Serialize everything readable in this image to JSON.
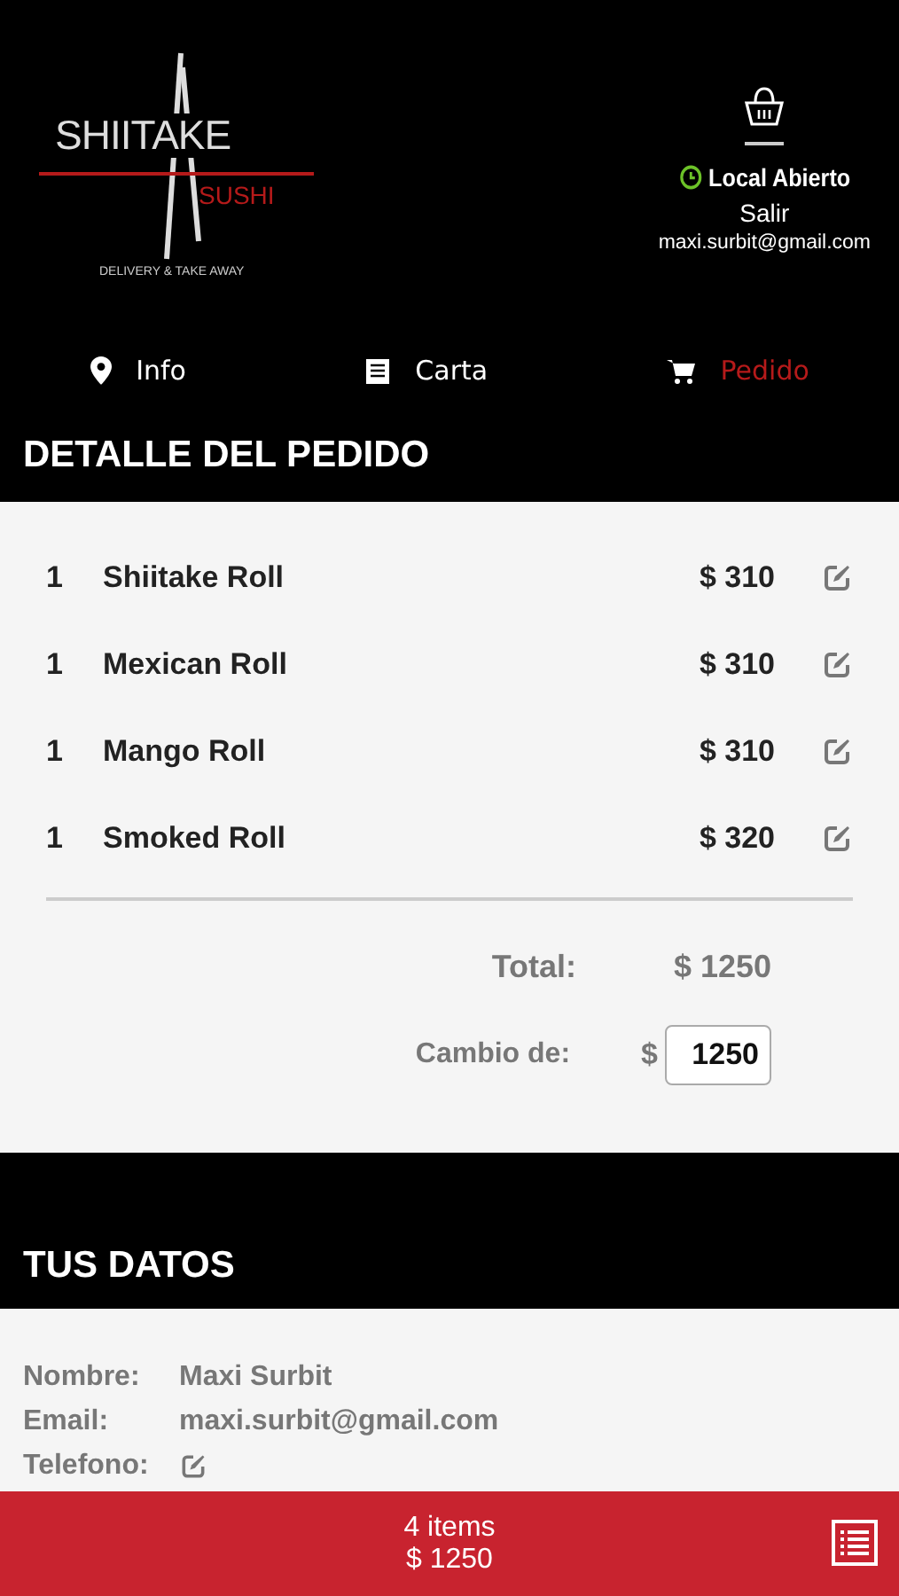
{
  "logo": {
    "name": "SHIITAKE",
    "sub": "SUSHI",
    "tagline": "DELIVERY & TAKE AWAY"
  },
  "store": {
    "status": "Local Abierto",
    "open": true,
    "logout": "Salir",
    "email": "maxi.surbit@gmail.com"
  },
  "tabs": [
    {
      "label": "Info",
      "kind": "pin",
      "selected": false
    },
    {
      "label": "Carta",
      "kind": "menu",
      "selected": false
    },
    {
      "label": "Pedido",
      "kind": "cart",
      "selected": true
    }
  ],
  "order": {
    "title": "DETALLE DEL PEDIDO",
    "items": [
      {
        "qty": "1",
        "name": "Shiitake Roll",
        "price": "$ 310"
      },
      {
        "qty": "1",
        "name": "Mexican Roll",
        "price": "$ 310"
      },
      {
        "qty": "1",
        "name": "Mango Roll",
        "price": "$ 310"
      },
      {
        "qty": "1",
        "name": "Smoked Roll",
        "price": "$ 320"
      }
    ],
    "total_label": "Total:",
    "total": "$ 1250",
    "change_label": "Cambio de:",
    "currency": "$",
    "change_value": "1250"
  },
  "customer": {
    "title": "TUS DATOS",
    "fields": [
      {
        "label": "Nombre:",
        "value": "Maxi Surbit",
        "kind": "text"
      },
      {
        "label": "Email:",
        "value": "maxi.surbit@gmail.com",
        "kind": "text"
      },
      {
        "label": "Telefono:",
        "kind": "edit"
      }
    ]
  },
  "cart_bar": {
    "count": "4 items",
    "total": "$ 1250"
  }
}
